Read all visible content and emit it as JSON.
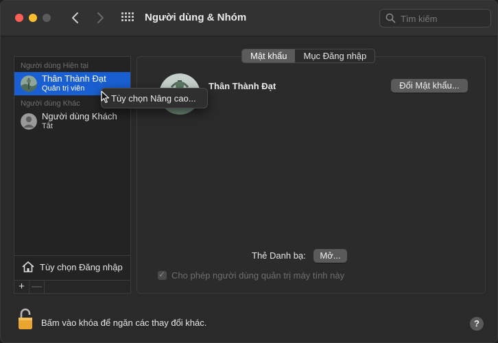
{
  "window": {
    "title": "Người dùng & Nhóm"
  },
  "toolbar": {
    "back_icon": "chevron-left-icon",
    "forward_icon": "chevron-right-icon",
    "grid_icon": "show-all-grid-icon",
    "search_placeholder": "Tìm kiếm"
  },
  "sidebar": {
    "current_header": "Người dùng Hiện tại",
    "other_header": "Người dùng Khác",
    "users": [
      {
        "name": "Thân Thành Đạt",
        "role": "Quản trị viên",
        "selected": true
      },
      {
        "name": "Người dùng Khách",
        "role": "Tắt",
        "selected": false
      }
    ],
    "login_options_label": "Tùy chọn Đăng nhập",
    "add_label": "+",
    "remove_label": "—"
  },
  "context_menu": {
    "item": "Tùy chọn Nâng cao..."
  },
  "main": {
    "tabs": [
      {
        "label": "Mật khẩu",
        "active": true
      },
      {
        "label": "Mục Đăng nhập",
        "active": false
      }
    ],
    "user_name": "Thân Thành Đạt",
    "change_password_label": "Đổi Mật khẩu...",
    "contact_card_label": "Thẻ Danh bạ:",
    "open_label": "Mở...",
    "allow_admin_label": "Cho phép người dùng quản trị máy tính này",
    "allow_admin_checked": true
  },
  "footer": {
    "lock_text": "Bấm vào khóa để ngăn các thay đổi khác.",
    "help_label": "?"
  },
  "colors": {
    "selection": "#1a5fd1",
    "close": "#fe5f57",
    "minimize": "#febc2e",
    "lock": "#e8a530"
  }
}
